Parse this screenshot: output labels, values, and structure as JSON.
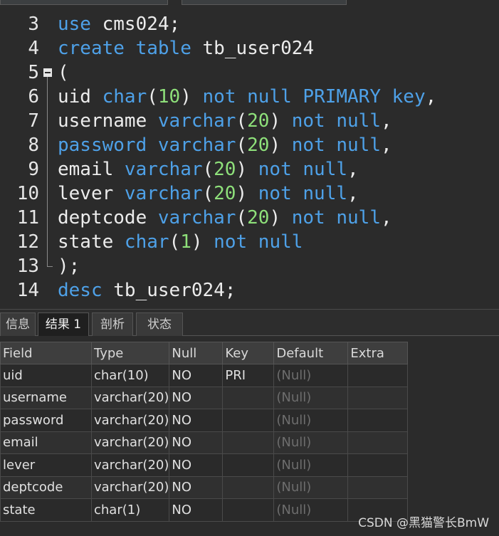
{
  "editor": {
    "lines": [
      {
        "num": "3",
        "tokens": [
          [
            "kw",
            "use"
          ],
          [
            "plain",
            " cms024;"
          ]
        ]
      },
      {
        "num": "4",
        "tokens": [
          [
            "kw",
            "create"
          ],
          [
            "plain",
            " "
          ],
          [
            "kw",
            "table"
          ],
          [
            "plain",
            " tb_user024"
          ]
        ]
      },
      {
        "num": "5",
        "tokens": [
          [
            "plain",
            "("
          ]
        ],
        "fold": true
      },
      {
        "num": "6",
        "tokens": [
          [
            "plain",
            "uid "
          ],
          [
            "kw",
            "char"
          ],
          [
            "plain",
            "("
          ],
          [
            "num",
            "10"
          ],
          [
            "plain",
            ") "
          ],
          [
            "kw",
            "not null PRIMARY key"
          ],
          [
            "plain",
            ","
          ]
        ]
      },
      {
        "num": "7",
        "tokens": [
          [
            "plain",
            "username "
          ],
          [
            "kw",
            "varchar"
          ],
          [
            "plain",
            "("
          ],
          [
            "num",
            "20"
          ],
          [
            "plain",
            ") "
          ],
          [
            "kw",
            "not null"
          ],
          [
            "plain",
            ","
          ]
        ]
      },
      {
        "num": "8",
        "tokens": [
          [
            "kw",
            "password"
          ],
          [
            "plain",
            " "
          ],
          [
            "kw",
            "varchar"
          ],
          [
            "plain",
            "("
          ],
          [
            "num",
            "20"
          ],
          [
            "plain",
            ") "
          ],
          [
            "kw",
            "not null"
          ],
          [
            "plain",
            ","
          ]
        ]
      },
      {
        "num": "9",
        "tokens": [
          [
            "plain",
            "email "
          ],
          [
            "kw",
            "varchar"
          ],
          [
            "plain",
            "("
          ],
          [
            "num",
            "20"
          ],
          [
            "plain",
            ") "
          ],
          [
            "kw",
            "not null"
          ],
          [
            "plain",
            ","
          ]
        ]
      },
      {
        "num": "10",
        "tokens": [
          [
            "plain",
            "lever "
          ],
          [
            "kw",
            "varchar"
          ],
          [
            "plain",
            "("
          ],
          [
            "num",
            "20"
          ],
          [
            "plain",
            ") "
          ],
          [
            "kw",
            "not null"
          ],
          [
            "plain",
            ","
          ]
        ]
      },
      {
        "num": "11",
        "tokens": [
          [
            "plain",
            "deptcode "
          ],
          [
            "kw",
            "varchar"
          ],
          [
            "plain",
            "("
          ],
          [
            "num",
            "20"
          ],
          [
            "plain",
            ") "
          ],
          [
            "kw",
            "not null"
          ],
          [
            "plain",
            ","
          ]
        ]
      },
      {
        "num": "12",
        "tokens": [
          [
            "plain",
            "state "
          ],
          [
            "kw",
            "char"
          ],
          [
            "plain",
            "("
          ],
          [
            "num",
            "1"
          ],
          [
            "plain",
            ") "
          ],
          [
            "kw",
            "not null"
          ]
        ]
      },
      {
        "num": "13",
        "tokens": [
          [
            "plain",
            ");"
          ]
        ],
        "fold_end": true
      },
      {
        "num": "14",
        "tokens": [
          [
            "kw",
            "desc"
          ],
          [
            "plain",
            " tb_user024;"
          ]
        ]
      }
    ]
  },
  "result_tabs": [
    {
      "label": "信息",
      "active": false
    },
    {
      "label": "结果 1",
      "active": true
    },
    {
      "label": "剖析",
      "active": false
    },
    {
      "label": "状态",
      "active": false
    }
  ],
  "grid": {
    "headers": [
      "Field",
      "Type",
      "Null",
      "Key",
      "Default",
      "Extra"
    ],
    "rows": [
      [
        "uid",
        "char(10)",
        "NO",
        "PRI",
        "(Null)",
        ""
      ],
      [
        "username",
        "varchar(20)",
        "NO",
        "",
        "(Null)",
        ""
      ],
      [
        "password",
        "varchar(20)",
        "NO",
        "",
        "(Null)",
        ""
      ],
      [
        "email",
        "varchar(20)",
        "NO",
        "",
        "(Null)",
        ""
      ],
      [
        "lever",
        "varchar(20)",
        "NO",
        "",
        "(Null)",
        ""
      ],
      [
        "deptcode",
        "varchar(20)",
        "NO",
        "",
        "(Null)",
        ""
      ],
      [
        "state",
        "char(1)",
        "NO",
        "",
        "(Null)",
        ""
      ]
    ]
  },
  "watermark": "CSDN @黑猫警长BmW",
  "colors": {
    "keyword": "#4ea1e8",
    "number": "#8ee07a",
    "text": "#ececec",
    "background": "#2b2b2b"
  }
}
